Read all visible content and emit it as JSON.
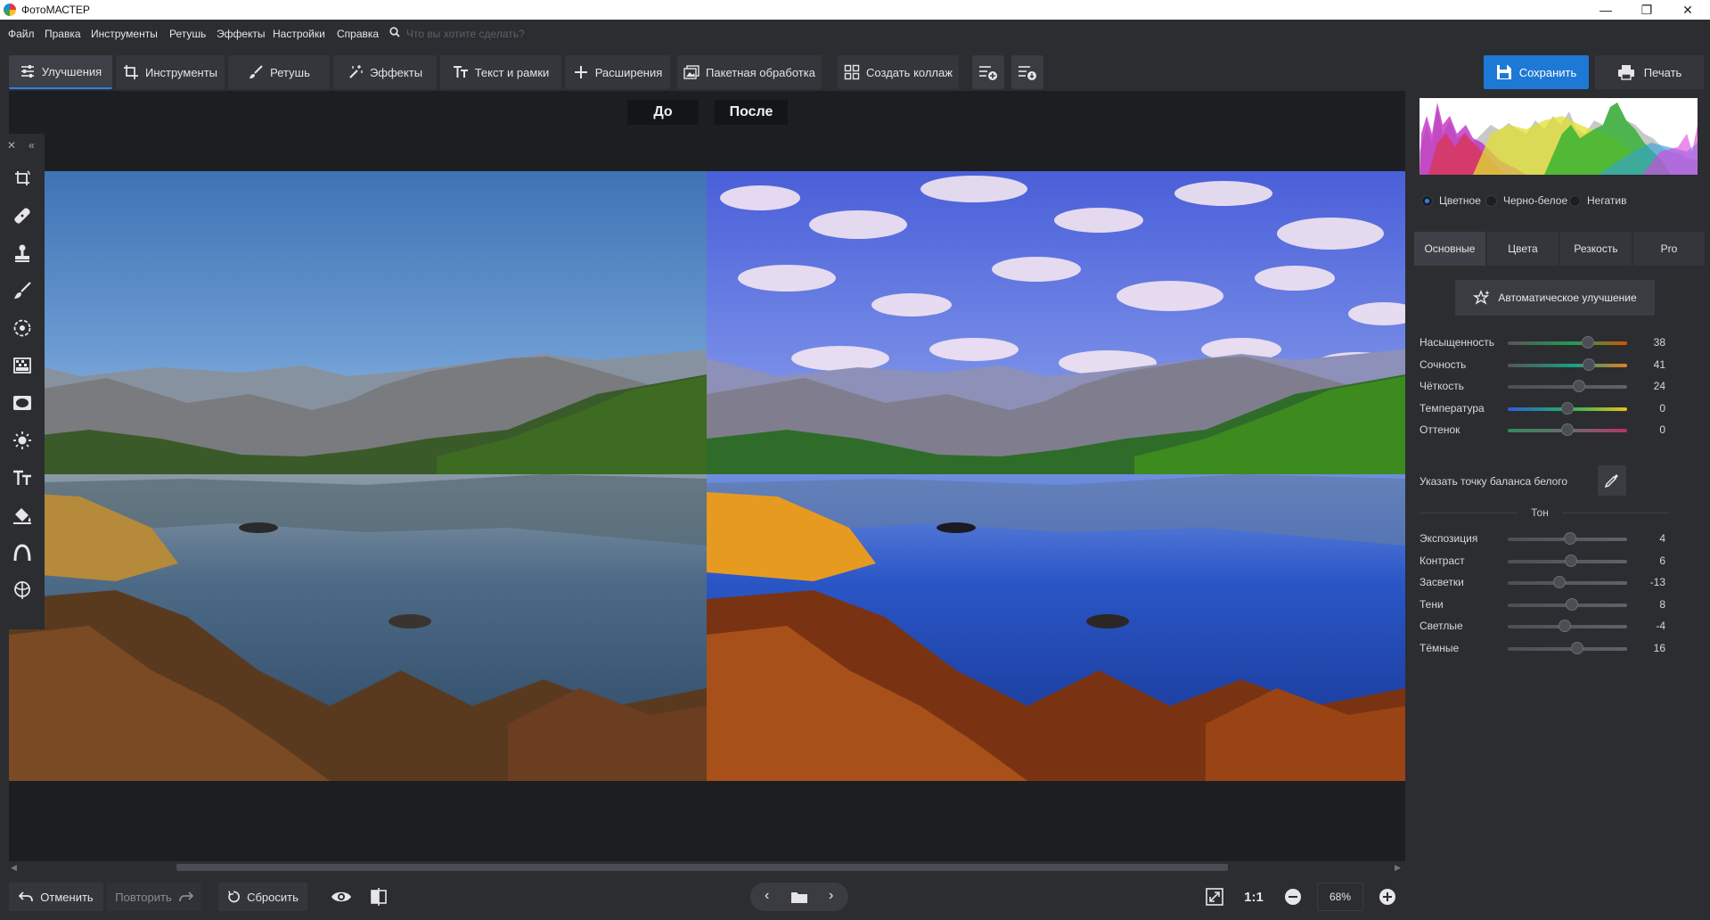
{
  "window": {
    "title": "ФотоМАСТЕР",
    "controls": [
      "—",
      "❐",
      "✕"
    ]
  },
  "menu": {
    "items": [
      "Файл",
      "Правка",
      "Инструменты",
      "Ретушь",
      "Эффекты",
      "Настройки",
      "Справка"
    ],
    "search_placeholder": "Что вы хотите сделать?"
  },
  "toolbar": {
    "tabs": [
      "Улучшения",
      "Инструменты",
      "Ретушь",
      "Эффекты",
      "Текст и рамки",
      "Расширения",
      "Пакетная обработка",
      "Создать коллаж"
    ],
    "active_tab": "Улучшения",
    "save_label": "Сохранить",
    "print_label": "Печать"
  },
  "canvas": {
    "before_label": "До",
    "after_label": "После"
  },
  "bottombar": {
    "undo_label": "Отменить",
    "redo_label": "Повторить",
    "reset_label": "Сбросить",
    "zoom_1to1": "1:1",
    "zoom_value": "68%"
  },
  "right_panel": {
    "color_modes": [
      {
        "label": "Цветное",
        "selected": true
      },
      {
        "label": "Черно-белое",
        "selected": false
      },
      {
        "label": "Негатив",
        "selected": false
      }
    ],
    "subtabs": [
      "Основные",
      "Цвета",
      "Резкость",
      "Pro"
    ],
    "active_subtab": "Основные",
    "auto_button": "Автоматическое улучшение",
    "color_sliders": [
      {
        "label": "Насыщенность",
        "value": "38",
        "level": 0.67
      },
      {
        "label": "Сочность",
        "value": "41",
        "level": 0.68
      },
      {
        "label": "Чёткость",
        "value": "24",
        "level": 0.6
      },
      {
        "label": "Температура",
        "value": "0",
        "level": 0.5
      },
      {
        "label": "Оттенок",
        "value": "0",
        "level": 0.5
      }
    ],
    "white_balance_label": "Указать точку баланса белого",
    "tone_title": "Тон",
    "tone_sliders": [
      {
        "label": "Экспозиция",
        "value": "4",
        "level": 0.52
      },
      {
        "label": "Контраст",
        "value": "6",
        "level": 0.53
      },
      {
        "label": "Засветки",
        "value": "-13",
        "level": 0.43
      },
      {
        "label": "Тени",
        "value": "8",
        "level": 0.54
      },
      {
        "label": "Светлые",
        "value": "-4",
        "level": 0.48
      },
      {
        "label": "Тёмные",
        "value": "16",
        "level": 0.58
      }
    ]
  },
  "colors": {
    "accent": "#1e78d6",
    "panel": "#2b2d31",
    "canvas": "#1d1e22"
  }
}
